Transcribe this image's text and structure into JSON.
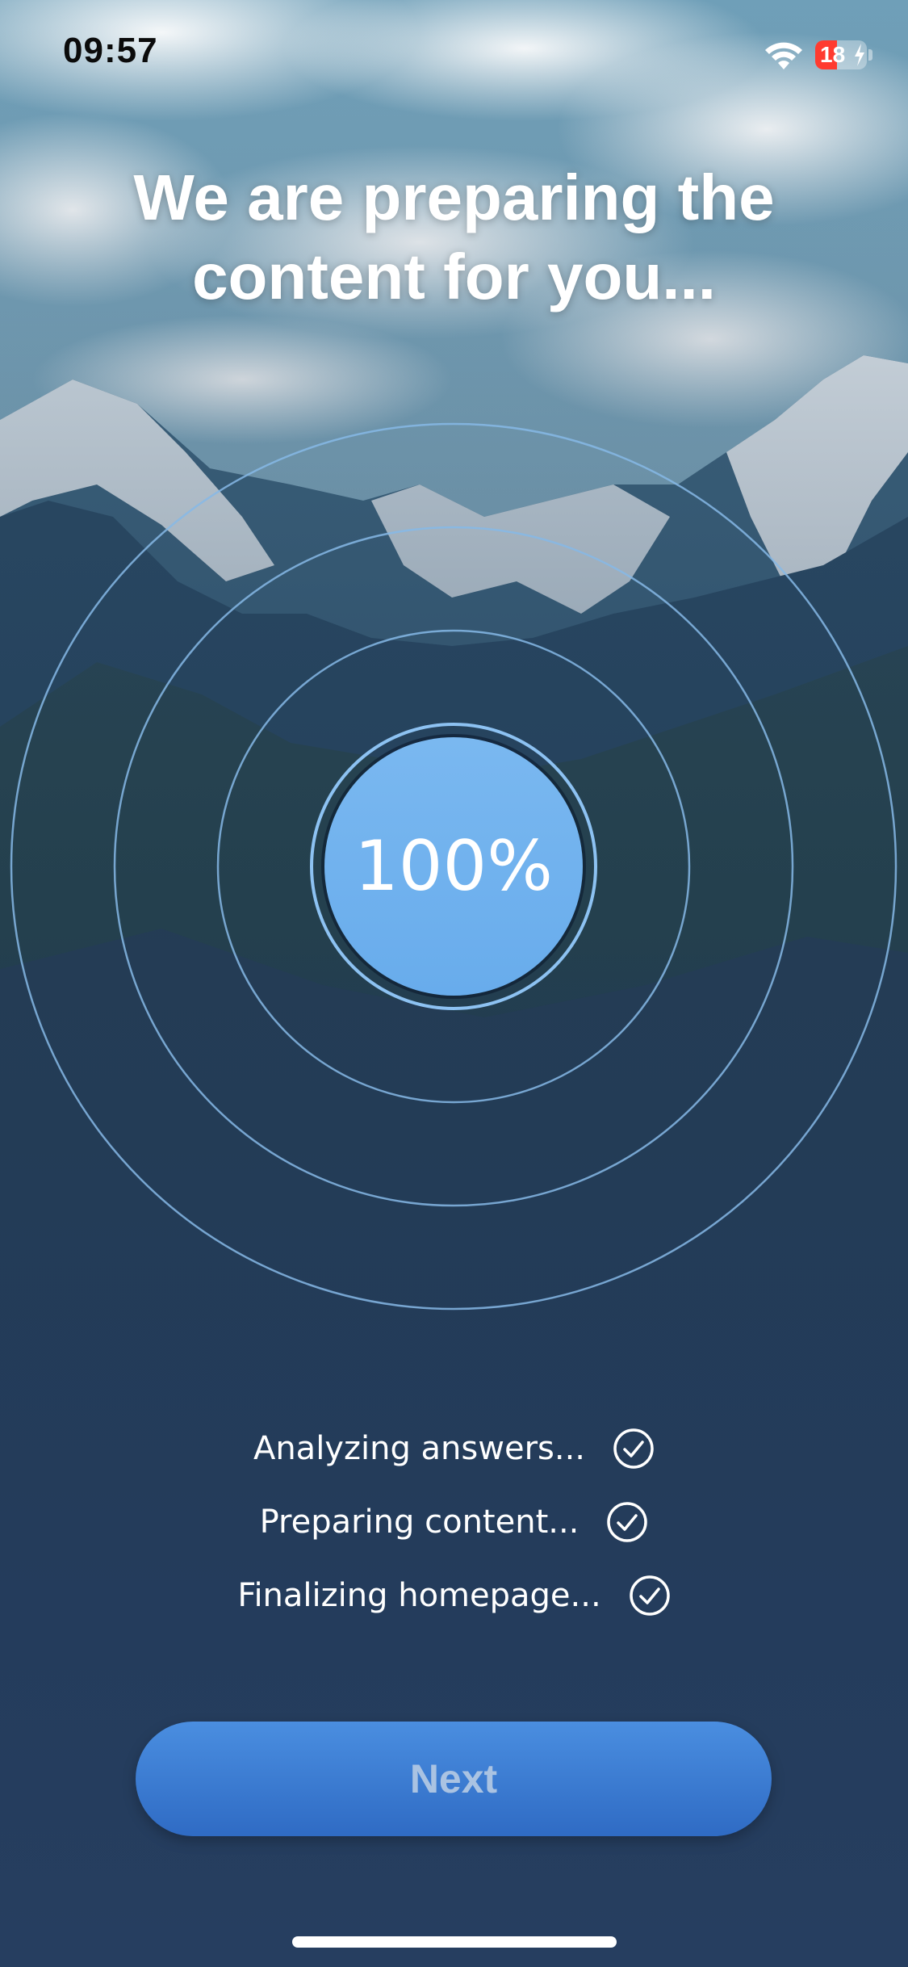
{
  "status_bar": {
    "time": "09:57",
    "battery_label": "18",
    "battery_level": 0.18,
    "battery_color": "#ff3b30",
    "wifi_icon": "wifi-icon",
    "charging_icon": "bolt-icon"
  },
  "headline": {
    "line1": "We are preparing the",
    "line2": "content for you..."
  },
  "progress": {
    "label": "100%",
    "value": 1.0,
    "accent_color": "#6cb0ee"
  },
  "steps": [
    {
      "label": "Analyzing answers...",
      "icon": "check-circle-icon",
      "done": true
    },
    {
      "label": "Preparing content...",
      "icon": "check-circle-icon",
      "done": true
    },
    {
      "label": "Finalizing homepage...",
      "icon": "check-circle-icon",
      "done": true
    }
  ],
  "next_button": {
    "label": "Next",
    "color": "#3a7bd5"
  }
}
